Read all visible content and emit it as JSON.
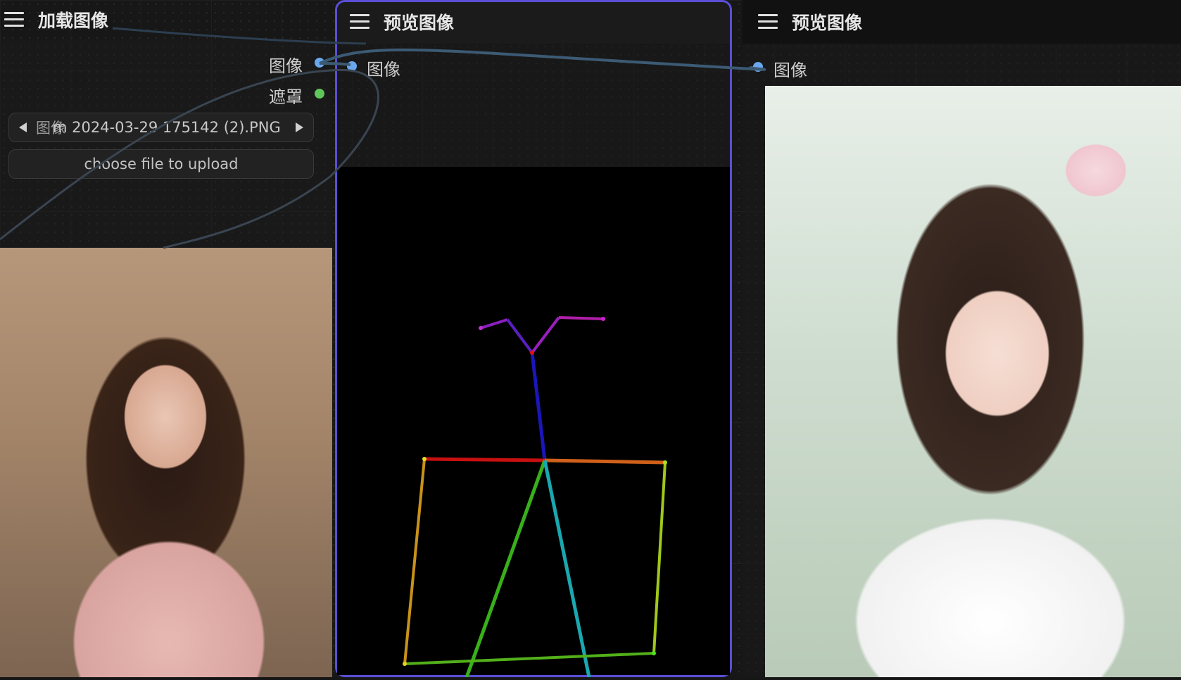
{
  "nodes": {
    "load_image": {
      "title": "加载图像",
      "outputs": [
        {
          "label": "图像",
          "color": "#6aa8ee"
        },
        {
          "label": "遮罩",
          "color": "#5fc65a"
        }
      ],
      "widgets": {
        "image_select": {
          "name": "图像",
          "value": "m 2024-03-29 175142 (2).PNG"
        },
        "upload_button": "choose file to upload"
      }
    },
    "preview_image_1": {
      "title": "预览图像",
      "inputs": [
        {
          "label": "图像",
          "color": "#6aa8ee"
        }
      ]
    },
    "preview_image_2": {
      "title": "预览图像",
      "inputs": [
        {
          "label": "图像",
          "color": "#6aa8ee"
        }
      ]
    }
  },
  "icons": [
    "menu-icon",
    "arrow-left-icon",
    "arrow-right-icon"
  ],
  "colors": {
    "selected_border": "#5a4fd6",
    "image_socket": "#6aa8ee",
    "mask_socket": "#5fc65a",
    "wire": "#3c5a74"
  }
}
